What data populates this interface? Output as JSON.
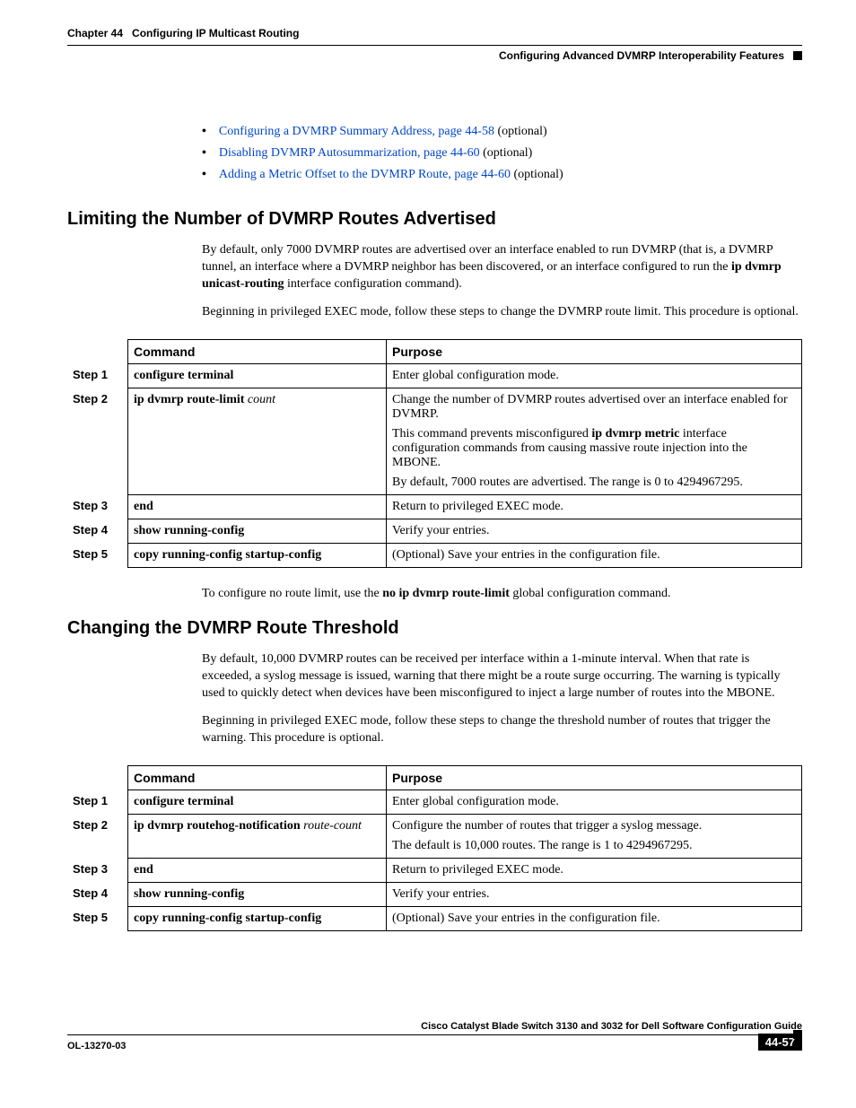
{
  "header": {
    "chapter": "Chapter 44",
    "title": "Configuring IP Multicast Routing",
    "section": "Configuring Advanced DVMRP Interoperability Features"
  },
  "bullets": [
    {
      "link": "Configuring a DVMRP Summary Address, page 44-58",
      "suffix": " (optional)"
    },
    {
      "link": "Disabling DVMRP Autosummarization, page 44-60",
      "suffix": " (optional)"
    },
    {
      "link": "Adding a Metric Offset to the DVMRP Route, page 44-60",
      "suffix": " (optional)"
    }
  ],
  "sec1": {
    "heading": "Limiting the Number of DVMRP Routes Advertised",
    "p1a": "By default, only 7000 DVMRP routes are advertised over an interface enabled to run DVMRP (that is, a DVMRP tunnel, an interface where a DVMRP neighbor has been discovered, or an interface configured to run the ",
    "p1cmd": "ip dvmrp unicast-routing",
    "p1b": " interface configuration command).",
    "p2": "Beginning in privileged EXEC mode, follow these steps to change the DVMRP route limit. This procedure is optional.",
    "th_cmd": "Command",
    "th_pur": "Purpose",
    "rows": [
      {
        "step": "Step 1",
        "cmd": "configure terminal",
        "arg": "",
        "pur": "Enter global configuration mode."
      },
      {
        "step": "Step 2",
        "cmd": "ip dvmrp route-limit ",
        "arg": "count",
        "pur": "Change the number of DVMRP routes advertised over an interface enabled for DVMRP.",
        "sub1a": "This command prevents misconfigured ",
        "sub1cmd": "ip dvmrp metric",
        "sub1b": " interface configuration commands from causing massive route injection into the MBONE.",
        "sub2": "By default, 7000 routes are advertised. The range is 0 to 4294967295."
      },
      {
        "step": "Step 3",
        "cmd": "end",
        "arg": "",
        "pur": "Return to privileged EXEC mode."
      },
      {
        "step": "Step 4",
        "cmd": "show running-config",
        "arg": "",
        "pur": "Verify your entries."
      },
      {
        "step": "Step 5",
        "cmd": "copy running-config startup-config",
        "arg": "",
        "pur": "(Optional) Save your entries in the configuration file."
      }
    ],
    "after_a": "To configure no route limit, use the ",
    "after_cmd": "no ip dvmrp route-limit",
    "after_b": " global configuration command."
  },
  "sec2": {
    "heading": "Changing the DVMRP Route Threshold",
    "p1": "By default, 10,000 DVMRP routes can be received per interface within a 1-minute interval. When that rate is exceeded, a syslog message is issued, warning that there might be a route surge occurring. The warning is typically used to quickly detect when devices have been misconfigured to inject a large number of routes into the MBONE.",
    "p2": "Beginning in privileged EXEC mode, follow these steps to change the threshold number of routes that trigger the warning. This procedure is optional.",
    "th_cmd": "Command",
    "th_pur": "Purpose",
    "rows": [
      {
        "step": "Step 1",
        "cmd": "configure terminal",
        "arg": "",
        "pur": "Enter global configuration mode."
      },
      {
        "step": "Step 2",
        "cmd": "ip dvmrp routehog-notification ",
        "arg": "route-count",
        "pur": "Configure the number of routes that trigger a syslog message.",
        "sub": "The default is 10,000 routes. The range is 1 to 4294967295."
      },
      {
        "step": "Step 3",
        "cmd": "end",
        "arg": "",
        "pur": "Return to privileged EXEC mode."
      },
      {
        "step": "Step 4",
        "cmd": "show running-config",
        "arg": "",
        "pur": "Verify your entries."
      },
      {
        "step": "Step 5",
        "cmd": "copy running-config startup-config",
        "arg": "",
        "pur": "(Optional) Save your entries in the configuration file."
      }
    ]
  },
  "footer": {
    "guide": "Cisco Catalyst Blade Switch 3130 and 3032 for Dell Software Configuration Guide",
    "docid": "OL-13270-03",
    "page": "44-57"
  }
}
